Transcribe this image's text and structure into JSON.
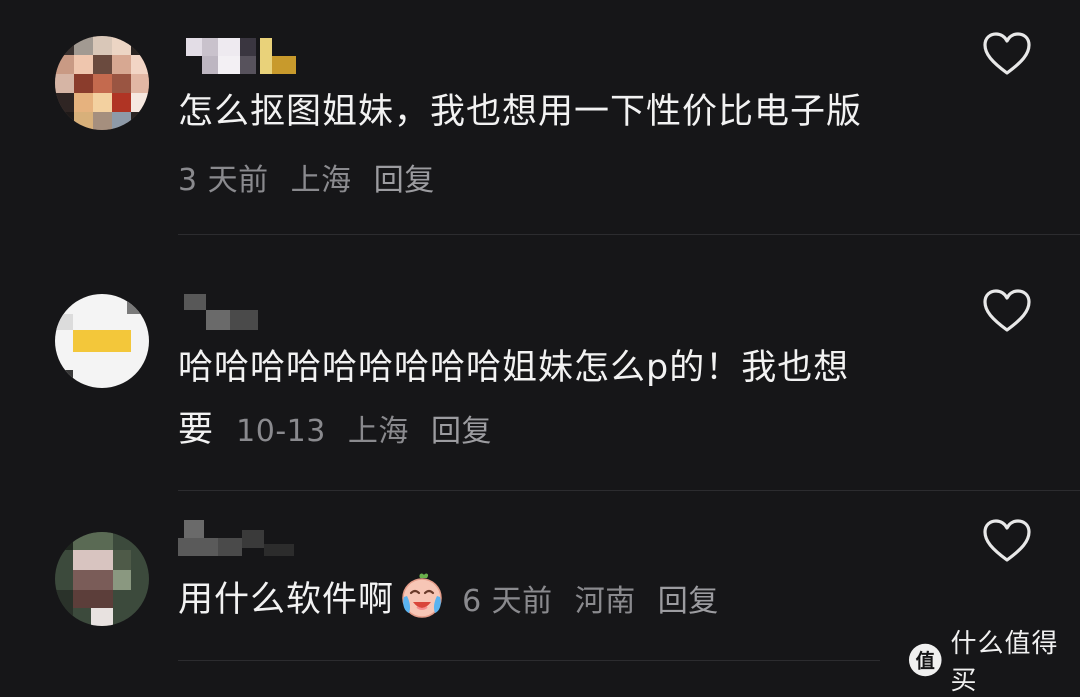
{
  "comments": [
    {
      "text": "怎么抠图姐妹，我也想用一下性价比电子版",
      "time": "3 天前",
      "location": "上海",
      "reply": "回复"
    },
    {
      "text_line1": "哈哈哈哈哈哈哈哈哈姐妹怎么p的！我也想",
      "text_line2": "要",
      "time": "10-13",
      "location": "上海",
      "reply": "回复"
    },
    {
      "text": "用什么软件啊",
      "emoji": "crying-laughing-baby-emoji",
      "time": "6 天前",
      "location": "河南",
      "reply": "回复"
    }
  ],
  "icons": {
    "like": "heart-outline-icon"
  },
  "watermark": {
    "logo": "值-logo",
    "text": "什么值得买"
  },
  "colors": {
    "background": "#161618",
    "text": "#f2f2f2",
    "meta": "#8a8a8e"
  }
}
